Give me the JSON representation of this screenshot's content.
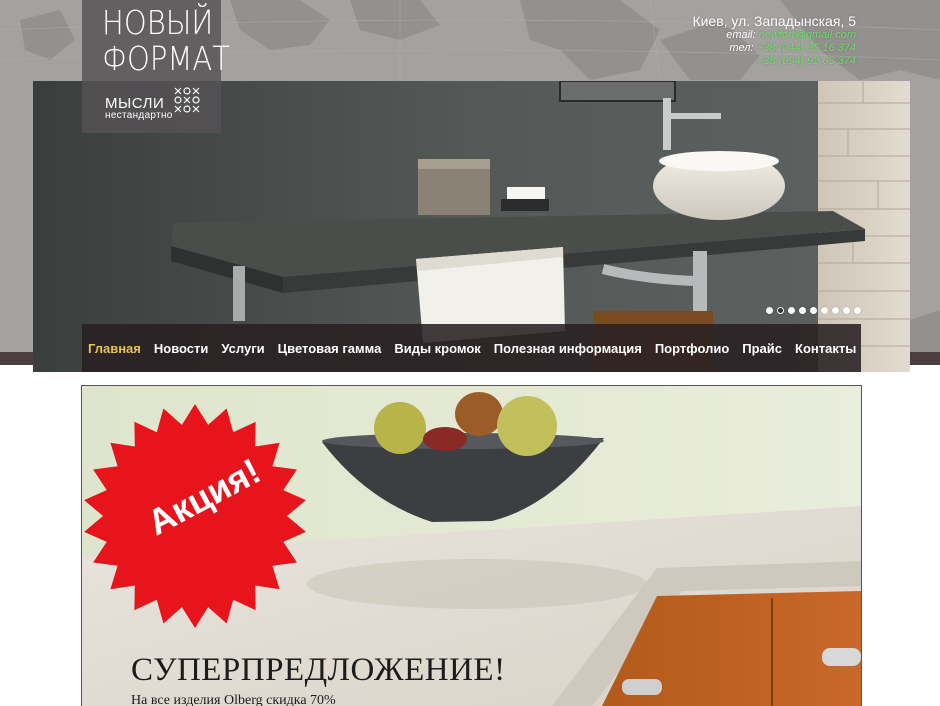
{
  "logo": {
    "line1": "НОВЫЙ",
    "line2": "ФОРМАТ",
    "tagline1": "МЫСЛИ",
    "tagline2": "нестандартно"
  },
  "contacts": {
    "address": "Киев, ул. Западынская, 5",
    "email_label": "email:",
    "email": "newfort@gmail.com",
    "phone_label": "тел:",
    "phone1": "+38 (044) 35 16 374",
    "phone2": "+38 (094) 92 63 374"
  },
  "menu": {
    "items": [
      {
        "label": "Главная",
        "active": true
      },
      {
        "label": "Новости"
      },
      {
        "label": "Услуги"
      },
      {
        "label": "Цветовая гамма"
      },
      {
        "label": "Виды кромок"
      },
      {
        "label": "Полезная информация"
      },
      {
        "label": "Портфолио"
      },
      {
        "label": "Прайс"
      },
      {
        "label": "Контакты"
      }
    ]
  },
  "slider": {
    "total": 9,
    "active_index": 1
  },
  "promo": {
    "badge": "Акция!",
    "headline": "СУПЕРПРЕДЛОЖЕНИЕ!",
    "subline": "На все изделия Olberg скидка 70%"
  },
  "colors": {
    "accent_active_menu": "#e8c24a",
    "contact_green": "#6edc6a",
    "badge_red": "#e8141c"
  }
}
